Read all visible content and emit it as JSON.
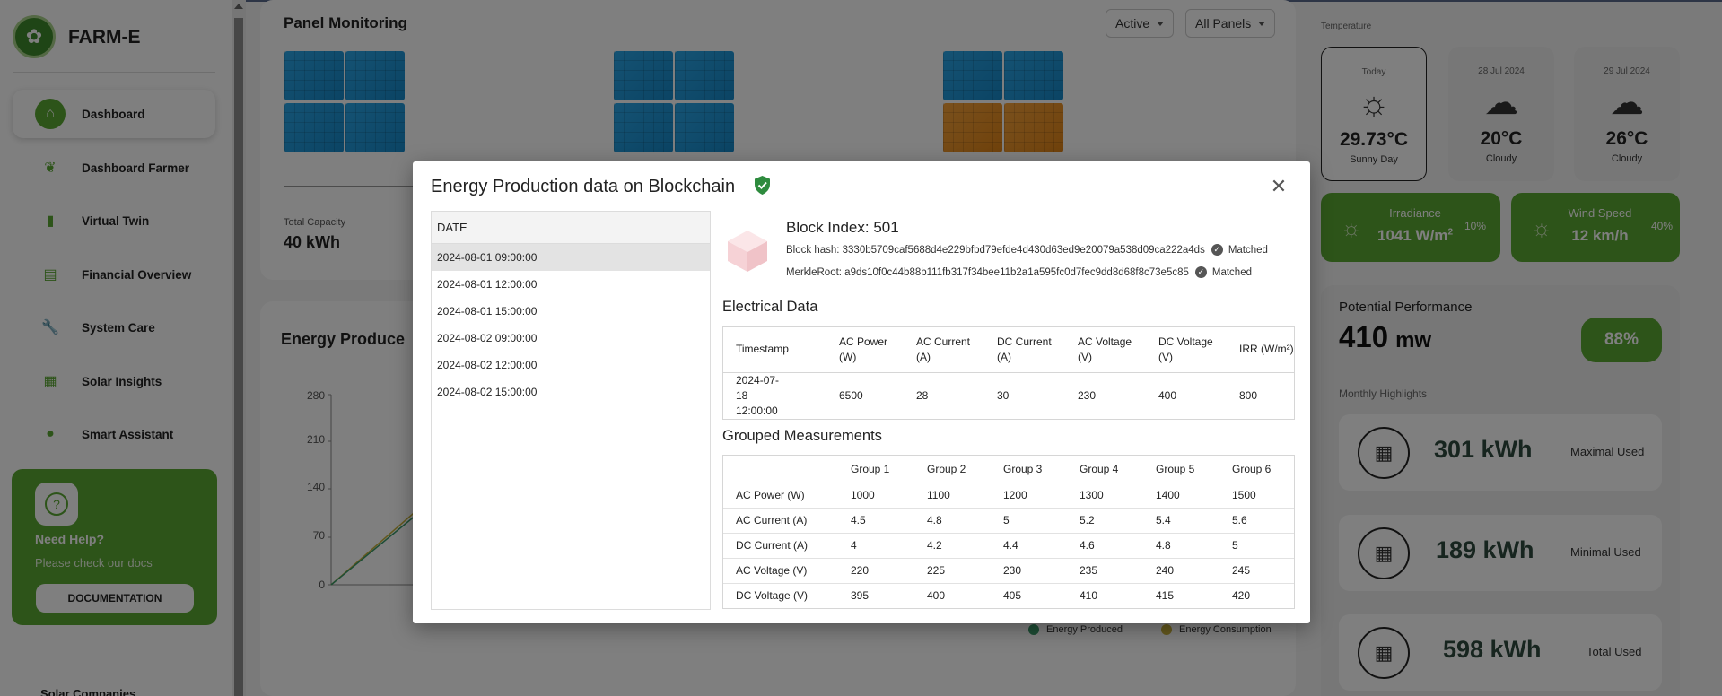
{
  "app": {
    "brand": "FARM-E"
  },
  "sidebar": {
    "items": [
      {
        "label": "Dashboard",
        "icon": "home-icon",
        "active": true
      },
      {
        "label": "Dashboard Farmer",
        "icon": "leaf-icon"
      },
      {
        "label": "Virtual Twin",
        "icon": "bar-chart-icon"
      },
      {
        "label": "Financial Overview",
        "icon": "credit-card-icon"
      },
      {
        "label": "System Care",
        "icon": "wrench-icon"
      },
      {
        "label": "Solar Insights",
        "icon": "book-icon"
      },
      {
        "label": "Smart Assistant",
        "icon": "chat-icon"
      }
    ],
    "help": {
      "title": "Need Help?",
      "subtitle": "Please check our docs",
      "button": "DOCUMENTATION"
    },
    "bottom_item": "Solar Companies"
  },
  "panel_monitoring": {
    "title": "Panel Monitoring",
    "filter_status": "Active",
    "filter_panels": "All Panels",
    "total_capacity_label": "Total Capacity",
    "total_capacity_value": "40 kWh"
  },
  "energy_chart": {
    "title": "Energy Produce",
    "yticks": [
      "280",
      "210",
      "140",
      "70",
      "0"
    ],
    "legend": [
      "Energy Produced",
      "Energy Consumption"
    ]
  },
  "weather": {
    "section_label": "Temperature",
    "days": [
      {
        "date": "Today",
        "temp": "29.73°C",
        "condition": "Sunny Day",
        "icon": "sun-icon"
      },
      {
        "date": "28 Jul 2024",
        "temp": "20°C",
        "condition": "Cloudy",
        "icon": "cloud-sun-icon"
      },
      {
        "date": "29 Jul 2024",
        "temp": "26°C",
        "condition": "Cloudy",
        "icon": "cloud-sun-icon"
      }
    ],
    "irradiance": {
      "label": "Irradiance",
      "value": "1041 W/m",
      "sup": "2",
      "pct": "10%"
    },
    "wind": {
      "label": "Wind Speed",
      "value": "12 km/h",
      "pct": "40%"
    }
  },
  "performance": {
    "title": "Potential Performance",
    "value": "410",
    "unit": "mw",
    "badge": "88%",
    "monthly_label": "Monthly Highlights",
    "highlights": [
      {
        "value": "301 kWh",
        "caption": "Maximal Used"
      },
      {
        "value": "189 kWh",
        "caption": "Minimal Used"
      },
      {
        "value": "598 kWh",
        "caption": "Total Used"
      }
    ]
  },
  "modal": {
    "title": "Energy Production data on Blockchain",
    "date_header": "DATE",
    "dates": [
      "2024-08-01 09:00:00",
      "2024-08-01 12:00:00",
      "2024-08-01 15:00:00",
      "2024-08-02 09:00:00",
      "2024-08-02 12:00:00",
      "2024-08-02 15:00:00"
    ],
    "selected_index": 0,
    "block_index": "Block Index: 501",
    "block_hash": "Block hash: 3330b5709caf5688d4e229bfbd79efde4d430d63ed9e20079a538d09ca222a4ds",
    "merkle_root": "MerkleRoot: a9ds10f0c44b88b111fb317f34bee11b2a1a595fc0d7fec9dd8d68f8c73e5c85",
    "matched_label": "Matched",
    "electrical": {
      "title": "Electrical Data",
      "headers": [
        "Timestamp",
        "AC Power (W)",
        "AC Current (A)",
        "DC Current (A)",
        "AC Voltage (V)",
        "DC Voltage (V)",
        "IRR (W/m²)"
      ],
      "row": [
        "2024-07-18 12:00:00",
        "6500",
        "28",
        "30",
        "230",
        "400",
        "800"
      ]
    },
    "grouped": {
      "title": "Grouped Measurements",
      "headers": [
        "",
        "Group 1",
        "Group 2",
        "Group 3",
        "Group 4",
        "Group 5",
        "Group 6"
      ],
      "rows": [
        [
          "AC Power (W)",
          "1000",
          "1100",
          "1200",
          "1300",
          "1400",
          "1500"
        ],
        [
          "AC Current (A)",
          "4.5",
          "4.8",
          "5",
          "5.2",
          "5.4",
          "5.6"
        ],
        [
          "DC Current (A)",
          "4",
          "4.2",
          "4.4",
          "4.6",
          "4.8",
          "5"
        ],
        [
          "AC Voltage (V)",
          "220",
          "225",
          "230",
          "235",
          "240",
          "245"
        ],
        [
          "DC Voltage (V)",
          "395",
          "400",
          "405",
          "410",
          "415",
          "420"
        ]
      ]
    }
  },
  "colors": {
    "brand_green": "#5aa832",
    "panel_blue": "#1e97d8",
    "panel_orange": "#ee9426",
    "verified_green": "#2e8b3e"
  }
}
